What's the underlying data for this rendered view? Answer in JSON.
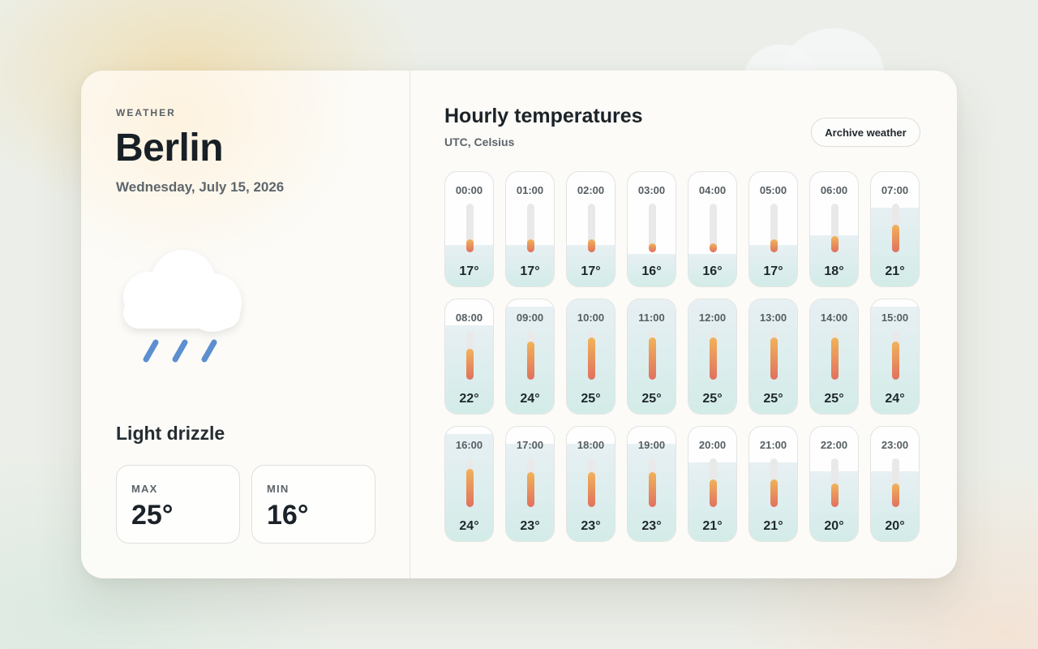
{
  "header": {
    "eyebrow": "WEATHER",
    "city": "Berlin",
    "date": "Wednesday, July 15, 2026"
  },
  "current": {
    "condition": "Light drizzle",
    "icon": "cloud-rain-icon",
    "max": {
      "label": "MAX",
      "value": "25°"
    },
    "min": {
      "label": "MIN",
      "value": "16°"
    }
  },
  "hourly": {
    "title": "Hourly temperatures",
    "subtitle": "UTC, Celsius",
    "archive_button": "Archive weather",
    "scale_min": 16,
    "scale_max": 25,
    "hours": [
      {
        "time": "00:00",
        "temp": 17,
        "label": "17°"
      },
      {
        "time": "01:00",
        "temp": 17,
        "label": "17°"
      },
      {
        "time": "02:00",
        "temp": 17,
        "label": "17°"
      },
      {
        "time": "03:00",
        "temp": 16,
        "label": "16°"
      },
      {
        "time": "04:00",
        "temp": 16,
        "label": "16°"
      },
      {
        "time": "05:00",
        "temp": 17,
        "label": "17°"
      },
      {
        "time": "06:00",
        "temp": 18,
        "label": "18°"
      },
      {
        "time": "07:00",
        "temp": 21,
        "label": "21°"
      },
      {
        "time": "08:00",
        "temp": 22,
        "label": "22°"
      },
      {
        "time": "09:00",
        "temp": 24,
        "label": "24°"
      },
      {
        "time": "10:00",
        "temp": 25,
        "label": "25°"
      },
      {
        "time": "11:00",
        "temp": 25,
        "label": "25°"
      },
      {
        "time": "12:00",
        "temp": 25,
        "label": "25°"
      },
      {
        "time": "13:00",
        "temp": 25,
        "label": "25°"
      },
      {
        "time": "14:00",
        "temp": 25,
        "label": "25°"
      },
      {
        "time": "15:00",
        "temp": 24,
        "label": "24°"
      },
      {
        "time": "16:00",
        "temp": 24,
        "label": "24°"
      },
      {
        "time": "17:00",
        "temp": 23,
        "label": "23°"
      },
      {
        "time": "18:00",
        "temp": 23,
        "label": "23°"
      },
      {
        "time": "19:00",
        "temp": 23,
        "label": "23°"
      },
      {
        "time": "20:00",
        "temp": 21,
        "label": "21°"
      },
      {
        "time": "21:00",
        "temp": 21,
        "label": "21°"
      },
      {
        "time": "22:00",
        "temp": 20,
        "label": "20°"
      },
      {
        "time": "23:00",
        "temp": 20,
        "label": "20°"
      }
    ]
  },
  "colors": {
    "bar_top": "#f0b35a",
    "bar_bottom": "#e0715f",
    "rain": "#5b8fd0",
    "fill": "#d3ece8"
  }
}
